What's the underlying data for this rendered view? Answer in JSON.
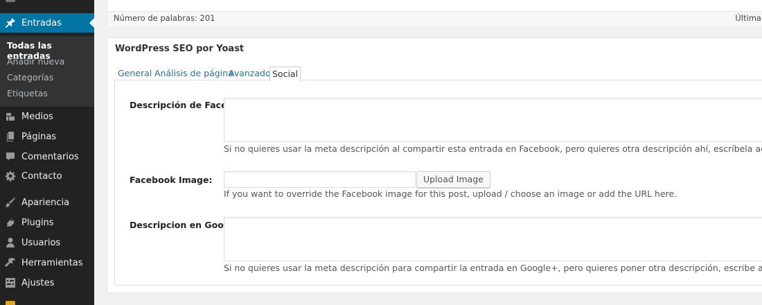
{
  "sidebar": {
    "entradas": "Entradas",
    "submenu": {
      "all": "Todas las entradas",
      "add": "Añadir nueva",
      "categories": "Categorías",
      "tags": "Etiquetas"
    },
    "medios": "Medios",
    "paginas": "Páginas",
    "comentarios": "Comentarios",
    "contacto": "Contacto",
    "apariencia": "Apariencia",
    "plugins": "Plugins",
    "usuarios": "Usuarios",
    "herramientas": "Herramientas",
    "ajustes": "Ajustes"
  },
  "status": {
    "word_count": "Número de palabras: 201",
    "last_edit": "Última ed"
  },
  "seo": {
    "title": "WordPress SEO por Yoast",
    "tabs": {
      "general": "General",
      "analysis": "Análisis de página",
      "advanced": "Avanzado",
      "social": "Social"
    },
    "active_tab": "Social",
    "fb_desc_label": "Descripción de Facebook:",
    "fb_desc_value": "",
    "fb_desc_help": "Si no quieres usar la meta descripción al compartir esta entrada en Facebook, pero quieres otra descripción ahí, escríbela aquí.",
    "fb_image_label": "Facebook Image:",
    "fb_image_value": "",
    "upload_button": "Upload Image",
    "fb_image_help": "If you want to override the Facebook image for this post, upload / choose an image or add the URL here.",
    "gplus_desc_label": "Descripcion en Google+:",
    "gplus_desc_value": "",
    "gplus_desc_help": "Si no quieres usar la meta descripción para compartir la entrada en Google+, pero quieres poner otra descripción, escribe aquí."
  },
  "colors": {
    "sidebar_bg": "#222222",
    "submenu_bg": "#333333",
    "current_menu": "#0074a2",
    "link": "#21759b"
  }
}
